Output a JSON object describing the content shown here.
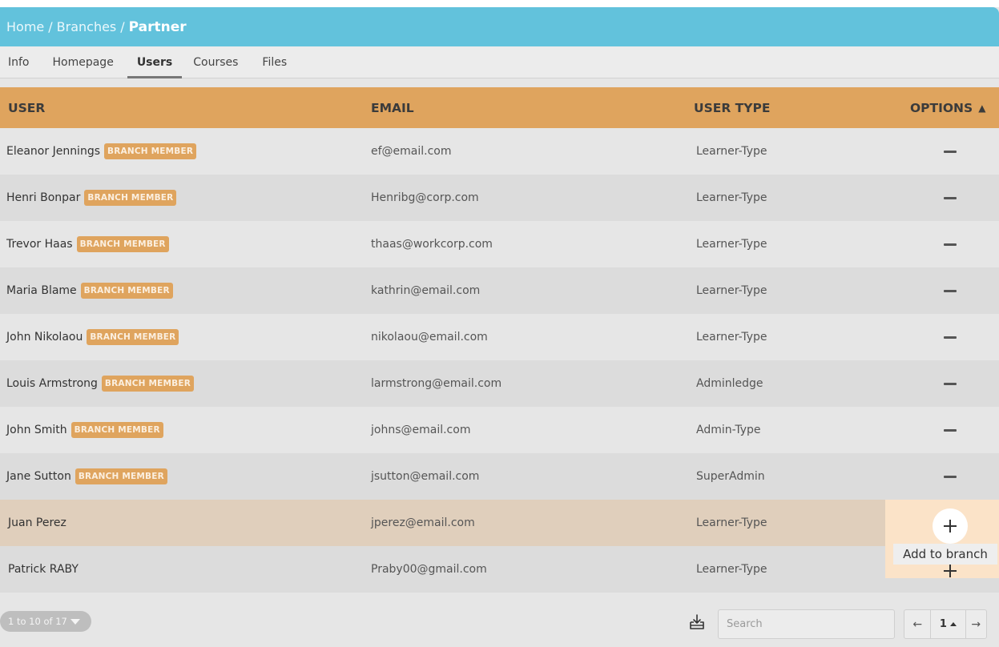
{
  "breadcrumb": {
    "home": "Home",
    "branches": "Branches",
    "current": "Partner",
    "separator": "/"
  },
  "tabs": [
    {
      "label": "Info"
    },
    {
      "label": "Homepage"
    },
    {
      "label": "Users"
    },
    {
      "label": "Courses"
    },
    {
      "label": "Files"
    }
  ],
  "active_tab": "Users",
  "table": {
    "headers": {
      "user": "USER",
      "email": "EMAIL",
      "user_type": "USER TYPE",
      "options": "OPTIONS"
    },
    "sort": {
      "column": "options",
      "direction": "asc",
      "icon": "caret-up-icon"
    },
    "badge_label": "BRANCH MEMBER",
    "rows": [
      {
        "name": "Eleanor Jennings",
        "email": "ef@email.com",
        "type": "Learner-Type",
        "member": true
      },
      {
        "name": "Henri Bonpar",
        "email": "Henribg@corp.com",
        "type": "Learner-Type",
        "member": true
      },
      {
        "name": "Trevor Haas",
        "email": "thaas@workcorp.com",
        "type": "Learner-Type",
        "member": true
      },
      {
        "name": "Maria Blame",
        "email": "kathrin@email.com",
        "type": "Learner-Type",
        "member": true
      },
      {
        "name": "John Nikolaou",
        "email": "nikolaou@email.com",
        "type": "Learner-Type",
        "member": true
      },
      {
        "name": "Louis Armstrong",
        "email": "larmstrong@email.com",
        "type": "Adminledge",
        "member": true
      },
      {
        "name": "John Smith",
        "email": "johns@email.com",
        "type": "Admin-Type",
        "member": true
      },
      {
        "name": "Jane Sutton",
        "email": "jsutton@email.com",
        "type": "SuperAdmin",
        "member": true
      },
      {
        "name": "Juan Perez",
        "email": "jperez@email.com",
        "type": "Learner-Type",
        "member": false
      },
      {
        "name": "Patrick RABY",
        "email": "Praby00@gmail.com",
        "type": "Learner-Type",
        "member": false
      }
    ],
    "highlighted_row": "Juan Perez"
  },
  "tooltip": {
    "text": "Add to branch"
  },
  "footer": {
    "pager_info": "1 to 10 of 17",
    "search_placeholder": "Search",
    "current_page": "1",
    "prev_symbol": "←",
    "next_symbol": "→",
    "download_icon": "download-icon"
  },
  "colors": {
    "breadcrumb_bg": "#62c2dc",
    "header_bg": "#dfa45e",
    "badge_bg": "#dfa45e",
    "highlight_row_bg": "#e0cfbc",
    "tooltip_panel_bg": "#fbe3c8"
  }
}
